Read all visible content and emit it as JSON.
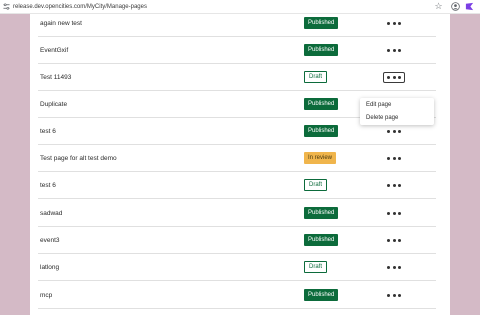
{
  "browser": {
    "url": "release.dev.opencities.com/MyCity/Manage-pages",
    "icons": [
      "tune-icon",
      "star-icon",
      "account-icon",
      "extension-icon"
    ]
  },
  "colors": {
    "published": "#0c6b3b",
    "draft_border": "#0c6b3b",
    "in_review": "#f0b54c",
    "backdrop": "#d4bac6"
  },
  "pages": [
    {
      "title": "again new test",
      "status": "Published",
      "kind": "published"
    },
    {
      "title": "EventGxif",
      "status": "Published",
      "kind": "published"
    },
    {
      "title": "Test 11493",
      "status": "Draft",
      "kind": "draft"
    },
    {
      "title": "Duplicate",
      "status": "Published",
      "kind": "published"
    },
    {
      "title": "test 6",
      "status": "Published",
      "kind": "published"
    },
    {
      "title": "Test page for alt test demo",
      "status": "In review",
      "kind": "review"
    },
    {
      "title": "test 6",
      "status": "Draft",
      "kind": "draft"
    },
    {
      "title": "sadwad",
      "status": "Published",
      "kind": "published"
    },
    {
      "title": "event3",
      "status": "Published",
      "kind": "published"
    },
    {
      "title": "latlong",
      "status": "Draft",
      "kind": "draft"
    },
    {
      "title": "mcp",
      "status": "Published",
      "kind": "published"
    }
  ],
  "context_menu": {
    "edit_label": "Edit page",
    "delete_label": "Delete page"
  }
}
